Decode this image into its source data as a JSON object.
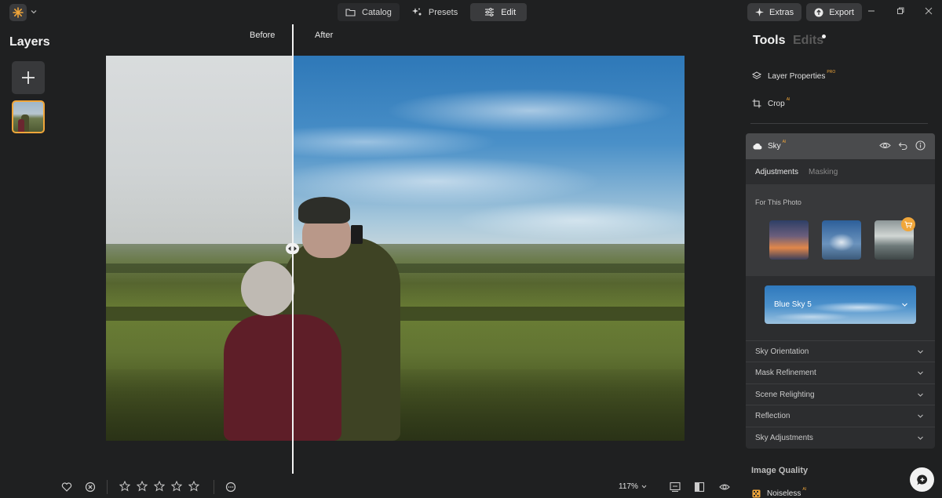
{
  "topbar": {
    "tabs": [
      {
        "label": "Catalog",
        "icon": "folder-icon"
      },
      {
        "label": "Presets",
        "icon": "sparkle-icon"
      },
      {
        "label": "Edit",
        "icon": "sliders-icon"
      }
    ],
    "active_tab": "Edit",
    "extras_label": "Extras",
    "export_label": "Export"
  },
  "layers": {
    "title": "Layers"
  },
  "canvas": {
    "before_label": "Before",
    "after_label": "After"
  },
  "bottombar": {
    "rating_stars": 5,
    "zoom": "117%"
  },
  "right_panel": {
    "tools_tab": "Tools",
    "edits_tab": "Edits",
    "tools": [
      {
        "label": "Layer Properties",
        "badge": "PRO",
        "icon": "layers-icon"
      },
      {
        "label": "Crop",
        "badge": "AI",
        "icon": "crop-icon"
      }
    ],
    "sky": {
      "title": "Sky",
      "badge": "AI",
      "subtabs": [
        "Adjustments",
        "Masking"
      ],
      "for_this_photo": "For This Photo",
      "selected_sky": "Blue Sky 5",
      "sections": [
        "Sky Orientation",
        "Mask Refinement",
        "Scene Relighting",
        "Reflection",
        "Sky Adjustments"
      ]
    },
    "image_quality": {
      "title": "Image Quality",
      "noiseless_label": "Noiseless",
      "noiseless_badge": "AI"
    }
  },
  "colors": {
    "accent": "#f0a63a",
    "background": "#1f2021",
    "panel": "#2c2d2f"
  }
}
